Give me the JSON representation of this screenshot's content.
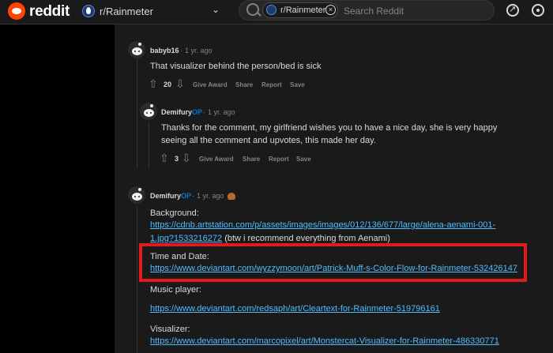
{
  "header": {
    "wordmark": "reddit",
    "subreddit": "r/Rainmeter",
    "search_chip": "r/Rainmeter",
    "search_placeholder": "Search Reddit"
  },
  "comments": [
    {
      "user": "babyb16",
      "op_badge": "",
      "time": "1 yr. ago",
      "body": "That visualizer behind the person/bed is sick",
      "votes": "20",
      "actions": [
        "Give Award",
        "Share",
        "Report",
        "Save"
      ]
    },
    {
      "user": "Demifury",
      "op_badge": "OP",
      "time": "1 yr. ago",
      "body_line1": "Thanks for the comment, my girlfriend wishes you to have a nice day, she is very happy",
      "body_line2": "seeing all the comment and upvotes, this made her day.",
      "votes": "3",
      "actions": [
        "Give Award",
        "Share",
        "Report",
        "Save"
      ]
    },
    {
      "user": "Demifury",
      "op_badge": "OP",
      "time": "1 yr. ago",
      "background_label": "Background:",
      "background_link_line1": "https://cdnb.artstation.com/p/assets/images/images/012/136/677/large/alena-aenami-001-",
      "background_link_line2": "1.jpg?1533216272",
      "background_note": " (btw i recommend everything from Aenami)",
      "time_label": "Time and Date:",
      "time_link": "https://www.deviantart.com/wyzzymoon/art/Patrick-Muff-s-Color-Flow-for-Rainmeter-532426147",
      "music_label": "Music player:",
      "music_link": "https://www.deviantart.com/redsaph/art/Cleartext-for-Rainmeter-519796161",
      "visualizer_label": "Visualizer:",
      "visualizer_link": "https://www.deviantart.com/marcopixel/art/Monstercat-Visualizer-for-Rainmeter-486330771"
    }
  ],
  "colors": {
    "accent": "#ff4500",
    "link": "#4fbcff",
    "op": "#0079d3",
    "highlight": "#e11b1b"
  }
}
